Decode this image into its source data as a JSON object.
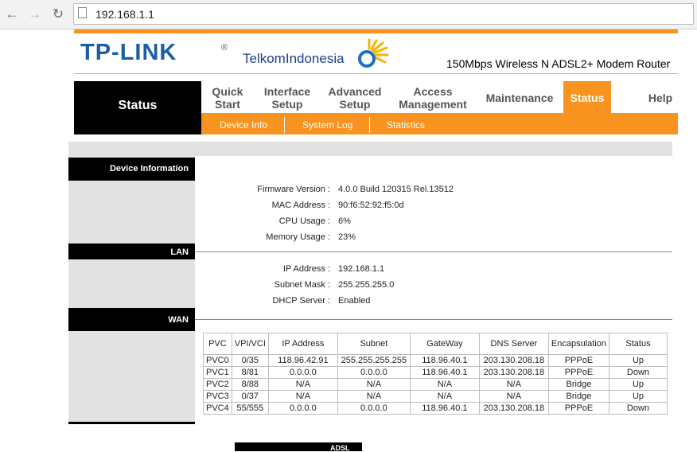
{
  "browser": {
    "url": "192.168.1.1"
  },
  "header": {
    "brand": "TP-LINK",
    "brand_reg": "®",
    "partner": "TelkomIndonesia",
    "model": "150Mbps Wireless N ADSL2+ Modem Router"
  },
  "nav": {
    "title": "Status",
    "items": [
      {
        "label": "Quick\nStart"
      },
      {
        "label": "Interface\nSetup"
      },
      {
        "label": "Advanced\nSetup"
      },
      {
        "label": "Access\nManagement"
      },
      {
        "label": "Maintenance"
      },
      {
        "label": "Status"
      },
      {
        "label": "Help"
      }
    ],
    "subitems": [
      {
        "label": "Device Info"
      },
      {
        "label": "System Log"
      },
      {
        "label": "Statistics"
      }
    ]
  },
  "device_info": {
    "section_title": "Device Information",
    "rows": [
      {
        "label": "Firmware Version :",
        "value": "4.0.0 Build 120315 Rel.13512"
      },
      {
        "label": "MAC Address :",
        "value": "90:f6:52:92:f5:0d"
      },
      {
        "label": "CPU Usage :",
        "value": "6%"
      },
      {
        "label": "Memory Usage :",
        "value": "23%"
      }
    ]
  },
  "lan": {
    "section_title": "LAN",
    "rows": [
      {
        "label": "IP Address :",
        "value": "192.168.1.1"
      },
      {
        "label": "Subnet Mask :",
        "value": "255.255.255.0"
      },
      {
        "label": "DHCP Server :",
        "value": "Enabled"
      }
    ]
  },
  "wan": {
    "section_title": "WAN",
    "columns": [
      "PVC",
      "VPI/VCI",
      "IP Address",
      "Subnet",
      "GateWay",
      "DNS Server",
      "Encapsulation",
      "Status"
    ],
    "rows": [
      [
        "PVC0",
        "0/35",
        "118.96.42.91",
        "255.255.255.255",
        "118.96.40.1",
        "203.130.208.18",
        "PPPoE",
        "Up"
      ],
      [
        "PVC1",
        "8/81",
        "0.0.0.0",
        "0.0.0.0",
        "118.96.40.1",
        "203.130.208.18",
        "PPPoE",
        "Down"
      ],
      [
        "PVC2",
        "8/88",
        "N/A",
        "N/A",
        "N/A",
        "N/A",
        "Bridge",
        "Up"
      ],
      [
        "PVC3",
        "0/37",
        "N/A",
        "N/A",
        "N/A",
        "N/A",
        "Bridge",
        "Up"
      ],
      [
        "PVC4",
        "55/555",
        "0.0.0.0",
        "0.0.0.0",
        "118.96.40.1",
        "203.130.208.18",
        "PPPoE",
        "Down"
      ]
    ]
  },
  "adsl": {
    "section_title": "ADSL"
  },
  "colors": {
    "accent": "#f7931e",
    "brand_blue": "#1b5fa3"
  }
}
